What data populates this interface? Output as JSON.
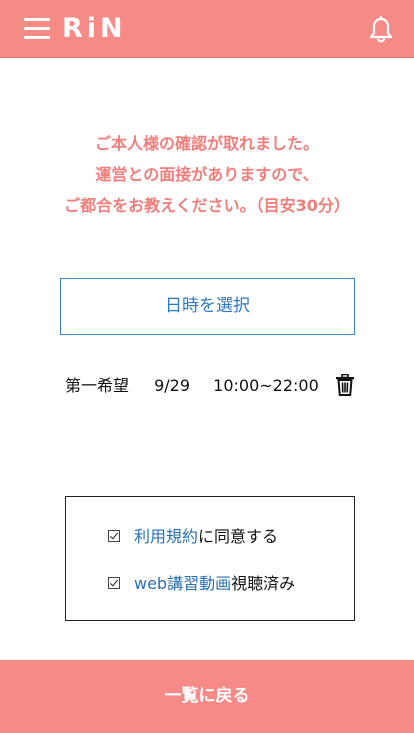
{
  "header": {
    "logo_text": "RiN",
    "menu_icon": "hamburger-menu-icon",
    "notification_icon": "bell-icon",
    "bg_color": "#f58a86"
  },
  "message": {
    "line1": "ご本人様の確認が取れました。",
    "line2": "運営との面接がありますので、",
    "line3": "ご都合をお教えください。（目安30分）",
    "color": "#f07e7a"
  },
  "date_select": {
    "label": "日時を選択",
    "color": "#3b82c9"
  },
  "choices": [
    {
      "label": "第一希望",
      "date": "9/29",
      "time": "10:00~22:00",
      "delete_icon": "trash-icon"
    }
  ],
  "agreements": [
    {
      "link_text": "利用規約",
      "text": "に同意する",
      "checked": true
    },
    {
      "link_text": "web講習動画",
      "text": "視聴済み",
      "checked": true
    }
  ],
  "footer": {
    "button_label": "一覧に戻る",
    "bg_color": "#f58a86"
  }
}
